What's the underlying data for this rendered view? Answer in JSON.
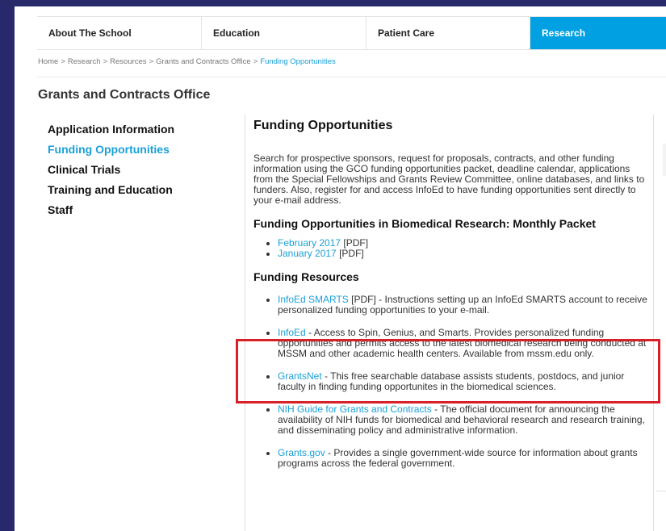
{
  "nav": {
    "items": [
      "About The School",
      "Education",
      "Patient Care",
      "Research"
    ],
    "active": "Research"
  },
  "breadcrumb": {
    "items": [
      "Home",
      "Research",
      "Resources",
      "Grants and Contracts Office"
    ],
    "current": "Funding Opportunities",
    "separator": ">"
  },
  "section_title": "Grants and Contracts Office",
  "sidebar": {
    "items": [
      "Application Information",
      "Funding Opportunities",
      "Clinical Trials",
      "Training and Education",
      "Staff"
    ],
    "active": "Funding Opportunities"
  },
  "content": {
    "title": "Funding Opportunities",
    "intro": "Search for prospective sponsors, request for proposals, contracts, and other funding information using the GCO funding opportunities packet, deadline calendar, applications from the Special Fellowships and Grants Review Committee, online databases, and links to funders. Also, register for and access InfoEd to have funding opportunities sent directly to your e-mail address.",
    "packet_heading": "Funding Opportunities in Biomedical Research: Monthly Packet",
    "packets": [
      {
        "link": "February 2017",
        "suffix": " [PDF]"
      },
      {
        "link": "January 2017",
        "suffix": " [PDF]"
      }
    ],
    "resources_heading": "Funding Resources",
    "resources": [
      {
        "link": "InfoEd SMARTS",
        "text": " [PDF] - Instructions setting up an InfoEd SMARTS account to receive personalized funding opportunities to your e-mail."
      },
      {
        "link": "InfoEd",
        "text": " - Access to Spin, Genius, and Smarts. Provides personalized funding opportunities and permits access to the latest biomedical research being conducted at MSSM and other academic health centers. Available from mssm.edu only."
      },
      {
        "link": "GrantsNet",
        "text": " - This free searchable database assists students, postdocs, and junior faculty in finding funding opportunites in the biomedical sciences."
      },
      {
        "link": "NIH Guide for Grants and Contracts",
        "text": " - The official document for announcing the availability of NIH funds for biomedical and behavioral research and research training, and disseminating policy and administrative information."
      },
      {
        "link": "Grants.gov",
        "text": " - Provides a single government-wide source for information about grants programs across the federal government."
      }
    ]
  },
  "colors": {
    "accent": "#00a0e3",
    "link": "#1aa0d8",
    "highlight": "#d6202a",
    "frame": "#28296b"
  }
}
